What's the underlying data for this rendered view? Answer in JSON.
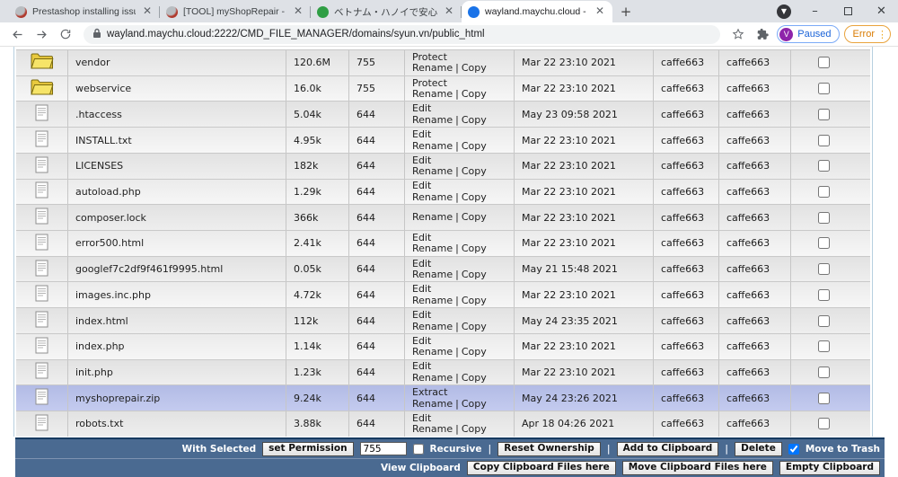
{
  "browser": {
    "tabs": [
      {
        "title": "Prestashop installing issue - Installa",
        "favicon": "#b9bdc1",
        "favicon2": "#b03a2e",
        "active": false
      },
      {
        "title": "[TOOL] myShopRepair - Check Pr",
        "favicon": "#b9bdc1",
        "favicon2": "#b03a2e",
        "active": false
      },
      {
        "title": "ベトナム・ハノイで安心安全・旬の野菜",
        "favicon": "#2f9e44",
        "favicon2": "#2f9e44",
        "active": false
      },
      {
        "title": "wayland.maychu.cloud - DirectAdm",
        "favicon": "#1a73e8",
        "favicon2": "#1a73e8",
        "active": true
      }
    ],
    "url": "wayland.maychu.cloud:2222/CMD_FILE_MANAGER/domains/syun.vn/public_html",
    "profile_badge": {
      "label": "Paused",
      "avatar_letter": "V",
      "avatar_color": "#8e24aa"
    },
    "error_badge": {
      "label": "Error"
    }
  },
  "table": {
    "labels": {
      "rename": "Rename",
      "copy": "Copy",
      "pipe": "|"
    },
    "rows": [
      {
        "name": "vendor",
        "type": "folder",
        "size": "120.6M",
        "perm": "755",
        "action": "Protect",
        "date": "Mar 22 23:10 2021",
        "owner": "caffe663",
        "group": "caffe663",
        "highlight": false
      },
      {
        "name": "webservice",
        "type": "folder",
        "size": "16.0k",
        "perm": "755",
        "action": "Protect",
        "date": "Mar 22 23:10 2021",
        "owner": "caffe663",
        "group": "caffe663",
        "highlight": false
      },
      {
        "name": ".htaccess",
        "type": "file",
        "size": "5.04k",
        "perm": "644",
        "action": "Edit",
        "date": "May 23 09:58 2021",
        "owner": "caffe663",
        "group": "caffe663",
        "highlight": false
      },
      {
        "name": "INSTALL.txt",
        "type": "file",
        "size": "4.95k",
        "perm": "644",
        "action": "Edit",
        "date": "Mar 22 23:10 2021",
        "owner": "caffe663",
        "group": "caffe663",
        "highlight": false
      },
      {
        "name": "LICENSES",
        "type": "file",
        "size": "182k",
        "perm": "644",
        "action": "Edit",
        "date": "Mar 22 23:10 2021",
        "owner": "caffe663",
        "group": "caffe663",
        "highlight": false
      },
      {
        "name": "autoload.php",
        "type": "file",
        "size": "1.29k",
        "perm": "644",
        "action": "Edit",
        "date": "Mar 22 23:10 2021",
        "owner": "caffe663",
        "group": "caffe663",
        "highlight": false
      },
      {
        "name": "composer.lock",
        "type": "file",
        "size": "366k",
        "perm": "644",
        "action": "",
        "date": "Mar 22 23:10 2021",
        "owner": "caffe663",
        "group": "caffe663",
        "highlight": false
      },
      {
        "name": "error500.html",
        "type": "file",
        "size": "2.41k",
        "perm": "644",
        "action": "Edit",
        "date": "Mar 22 23:10 2021",
        "owner": "caffe663",
        "group": "caffe663",
        "highlight": false
      },
      {
        "name": "googlef7c2df9f461f9995.html",
        "type": "file",
        "size": "0.05k",
        "perm": "644",
        "action": "Edit",
        "date": "May 21 15:48 2021",
        "owner": "caffe663",
        "group": "caffe663",
        "highlight": false
      },
      {
        "name": "images.inc.php",
        "type": "file",
        "size": "4.72k",
        "perm": "644",
        "action": "Edit",
        "date": "Mar 22 23:10 2021",
        "owner": "caffe663",
        "group": "caffe663",
        "highlight": false
      },
      {
        "name": "index.html",
        "type": "file",
        "size": "112k",
        "perm": "644",
        "action": "Edit",
        "date": "May 24 23:35 2021",
        "owner": "caffe663",
        "group": "caffe663",
        "highlight": false
      },
      {
        "name": "index.php",
        "type": "file",
        "size": "1.14k",
        "perm": "644",
        "action": "Edit",
        "date": "Mar 22 23:10 2021",
        "owner": "caffe663",
        "group": "caffe663",
        "highlight": false
      },
      {
        "name": "init.php",
        "type": "file",
        "size": "1.23k",
        "perm": "644",
        "action": "Edit",
        "date": "Mar 22 23:10 2021",
        "owner": "caffe663",
        "group": "caffe663",
        "highlight": false
      },
      {
        "name": "myshoprepair.zip",
        "type": "file",
        "size": "9.24k",
        "perm": "644",
        "action": "Extract",
        "date": "May 24 23:26 2021",
        "owner": "caffe663",
        "group": "caffe663",
        "highlight": true
      },
      {
        "name": "robots.txt",
        "type": "file",
        "size": "3.88k",
        "perm": "644",
        "action": "Edit",
        "date": "Apr 18 04:26 2021",
        "owner": "caffe663",
        "group": "caffe663",
        "highlight": false
      }
    ]
  },
  "footer": {
    "with_selected": "With Selected",
    "set_permission_button": "set Permission",
    "permission_value": "755",
    "recursive_label": "Recursive",
    "pipe": "|",
    "reset_ownership_button": "Reset Ownership",
    "add_to_clipboard_button": "Add to Clipboard",
    "delete_button": "Delete",
    "move_to_trash_label": "Move to Trash",
    "move_to_trash_checked": true,
    "recursive_checked": false,
    "view_clipboard_label": "View Clipboard",
    "copy_clipboard_button": "Copy Clipboard Files here",
    "move_clipboard_button": "Move Clipboard Files here",
    "empty_clipboard_button": "Empty Clipboard"
  }
}
